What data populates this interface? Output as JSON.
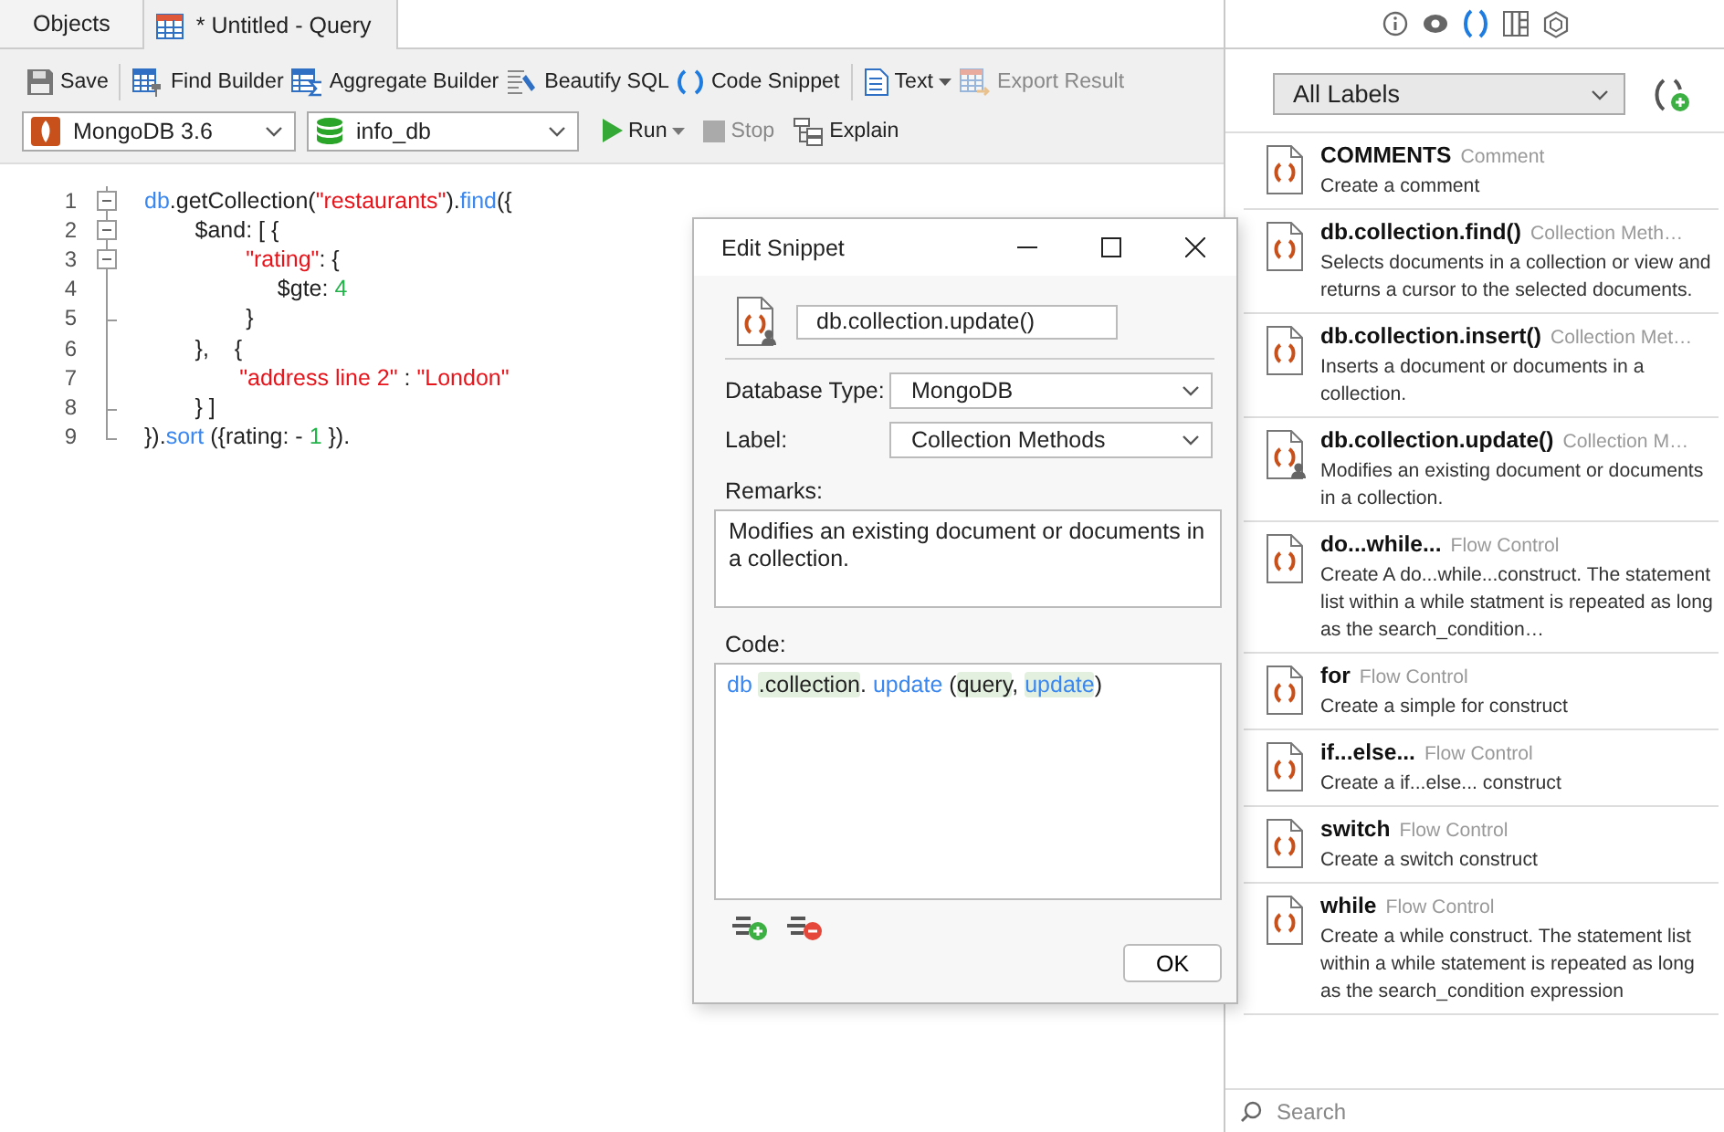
{
  "tabs": [
    {
      "label": "Objects",
      "selected": false
    },
    {
      "label": "* Untitled - Query",
      "selected": true
    }
  ],
  "toolbar": {
    "groups": [
      [
        {
          "label": "Save",
          "disabled": false
        }
      ],
      [
        {
          "label": "Find Builder",
          "disabled": false
        },
        {
          "label": "Aggregate Builder",
          "disabled": false
        },
        {
          "label": "Beautify SQL",
          "disabled": false
        },
        {
          "label": "Code Snippet",
          "disabled": false
        }
      ],
      [
        {
          "label": "Text",
          "disabled": false,
          "dropdown": true
        },
        {
          "label": "Export Result",
          "disabled": true
        }
      ]
    ]
  },
  "query_bar": {
    "connection": "MongoDB 3.6",
    "database": "info_db",
    "actions": [
      {
        "label": "Run",
        "disabled": false,
        "dropdown": true
      },
      {
        "label": "Stop",
        "disabled": true
      },
      {
        "label": "Explain",
        "disabled": false
      }
    ]
  },
  "editor": {
    "lines": [
      {
        "number": "1",
        "kind": "fold_start",
        "tokens": [
          {
            "kind": "keyword",
            "text": "db"
          },
          {
            "kind": "plain",
            "text": ".getCollection("
          },
          {
            "kind": "string",
            "text": "\"restaurants\""
          },
          {
            "kind": "plain",
            "text": ")."
          },
          {
            "kind": "keyword",
            "text": "find"
          },
          {
            "kind": "plain",
            "text": "({"
          }
        ]
      },
      {
        "number": "2",
        "kind": "fold_start",
        "tokens": [
          {
            "kind": "plain",
            "text": "        $and: [ {"
          }
        ]
      },
      {
        "number": "3",
        "kind": "fold_start",
        "tokens": [
          {
            "kind": "string",
            "text": "                \"rating\""
          },
          {
            "kind": "plain",
            "text": ": {"
          }
        ]
      },
      {
        "number": "4",
        "kind": "fold_line",
        "tokens": [
          {
            "kind": "plain",
            "text": "                     $gte: "
          },
          {
            "kind": "number",
            "text": "4"
          }
        ]
      },
      {
        "number": "5",
        "kind": "fold_end",
        "tokens": [
          {
            "kind": "plain",
            "text": "                }"
          }
        ]
      },
      {
        "number": "6",
        "kind": "fold_line",
        "tokens": [
          {
            "kind": "plain",
            "text": "        },    {"
          }
        ]
      },
      {
        "number": "7",
        "kind": "fold_line",
        "tokens": [
          {
            "kind": "string",
            "text": "               \"address line 2\""
          },
          {
            "kind": "plain",
            "text": " : "
          },
          {
            "kind": "string",
            "text": "\"London\""
          }
        ]
      },
      {
        "number": "8",
        "kind": "fold_end",
        "tokens": [
          {
            "kind": "plain",
            "text": "        } ]"
          }
        ]
      },
      {
        "number": "9",
        "kind": "fold_last",
        "tokens": [
          {
            "kind": "plain",
            "text": "})."
          },
          {
            "kind": "keyword",
            "text": "sort"
          },
          {
            "kind": "plain",
            "text": " ({rating: - "
          },
          {
            "kind": "number",
            "text": "1"
          },
          {
            "kind": "plain",
            "text": " })."
          }
        ]
      }
    ]
  },
  "dialog": {
    "title": "Edit Snippet",
    "name": "db.collection.update()",
    "custom": true,
    "fields": [
      {
        "label": "Database Type:",
        "value": "MongoDB"
      },
      {
        "label": "Label:",
        "value": "Collection Methods"
      }
    ],
    "remarks_label": "Remarks:",
    "remarks": "Modifies an existing document or documents in a collection.",
    "code_label": "Code:",
    "code": [
      {
        "kind": "keyword",
        "text": "db "
      },
      {
        "kind": "param",
        "text": ".collection"
      },
      {
        "kind": "plain",
        "text": ". "
      },
      {
        "kind": "keyword",
        "text": "update"
      },
      {
        "kind": "plain",
        "text": " ("
      },
      {
        "kind": "param",
        "text": "query"
      },
      {
        "kind": "plain",
        "text": ", "
      },
      {
        "kind": "param_keyword",
        "text": "update"
      },
      {
        "kind": "plain",
        "text": ")"
      }
    ],
    "ok": "OK"
  },
  "panel": {
    "tabs": [
      {
        "selected": false
      },
      {
        "selected": false
      },
      {
        "selected": true
      },
      {
        "selected": false
      },
      {
        "selected": false
      }
    ],
    "label_filter": "All Labels",
    "snippets": [
      {
        "title": "COMMENTS",
        "category": "Comment",
        "description": "Create a comment",
        "custom": false
      },
      {
        "title": "db.collection.find()",
        "category": "Collection Meth…",
        "description": "Selects documents in a collection or view and returns a cursor to the selected documents.",
        "custom": false
      },
      {
        "title": "db.collection.insert()",
        "category": "Collection Met…",
        "description": "Inserts  a document or documents in a collection.",
        "custom": false
      },
      {
        "title": "db.collection.update()",
        "category": "Collection M…",
        "description": "Modifies an existing document or documents in  a collection.",
        "custom": true
      },
      {
        "title": "do...while...",
        "category": "Flow Control",
        "description": "Create A do...while...construct. The statement list within a while statment is repeated as long as the search_condition…",
        "custom": false
      },
      {
        "title": "for",
        "category": "Flow Control",
        "description": "Create a simple for construct",
        "custom": false
      },
      {
        "title": "if...else...",
        "category": "Flow Control",
        "description": "Create a if...else... construct",
        "custom": false
      },
      {
        "title": "switch",
        "category": "Flow Control",
        "description": "Create a switch construct",
        "custom": false
      },
      {
        "title": "while",
        "category": "Flow Control",
        "description": "Create a while construct. The statement list within a while statement is repeated as long as the search_condition expression",
        "custom": false
      }
    ],
    "search": {
      "placeholder": "Search"
    }
  }
}
